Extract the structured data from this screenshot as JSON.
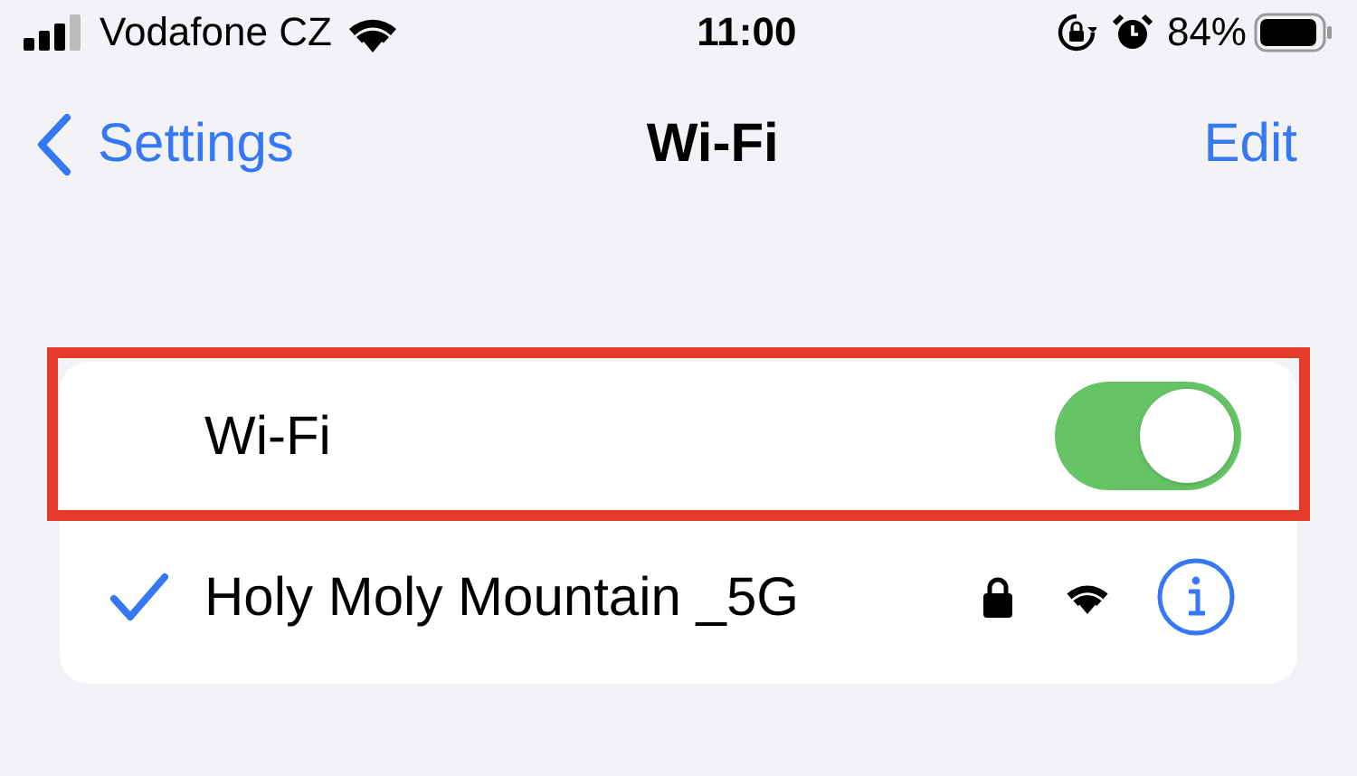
{
  "status_bar": {
    "carrier": "Vodafone CZ",
    "time": "11:00",
    "battery": "84%"
  },
  "nav": {
    "back": "Settings",
    "title": "Wi-Fi",
    "action": "Edit"
  },
  "wifi_row": {
    "label": "Wi-Fi",
    "on": true,
    "highlighted": true
  },
  "networks": [
    {
      "name": "Holy Moly Mountain _5G",
      "selected": true,
      "locked": true
    }
  ]
}
